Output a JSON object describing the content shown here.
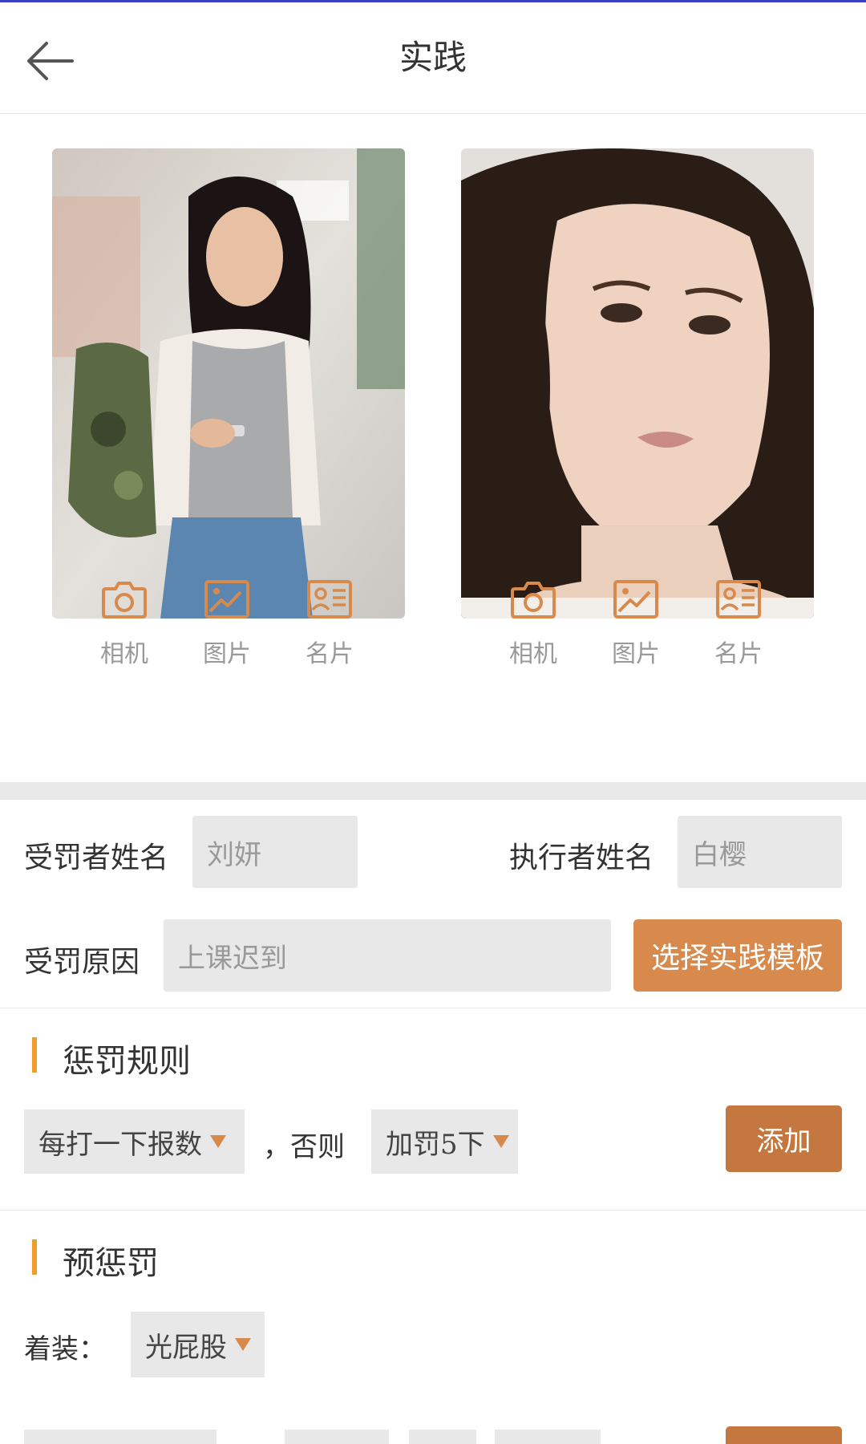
{
  "header": {
    "title": "实践"
  },
  "photos": {
    "left_alt": "受罚者照片",
    "right_alt": "执行者照片"
  },
  "tools": {
    "camera": "相机",
    "gallery": "图片",
    "card": "名片"
  },
  "form": {
    "punished_label": "受罚者姓名",
    "punished_value": "刘妍",
    "executor_label": "执行者姓名",
    "executor_value": "白樱",
    "reason_label": "受罚原因",
    "reason_value": "上课迟到",
    "template_button": "选择实践模板"
  },
  "rules": {
    "title": "惩罚规则",
    "rule_select": "每打一下报数",
    "otherwise": "，否则",
    "penalty_select": "加罚5下",
    "add_button": "添加"
  },
  "pre": {
    "title": "预惩罚",
    "attire_label": "着装：",
    "attire_select": "光屁股"
  },
  "colors": {
    "accent": "#d88a4c",
    "accent_dark": "#c4783f",
    "section_bar": "#f39a2c",
    "field_bg": "#e8e8e8"
  }
}
